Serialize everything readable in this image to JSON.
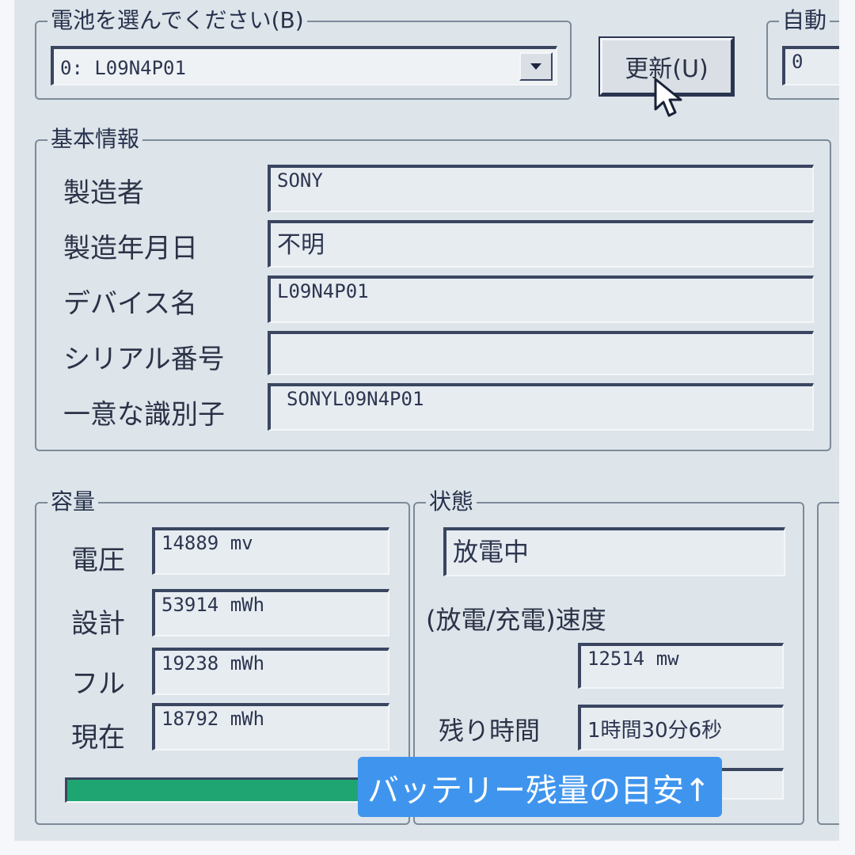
{
  "battery_select": {
    "legend": "電池を選んでください(B)",
    "selected": "0: L09N4P01",
    "refresh_label": "更新(U)"
  },
  "auto_update": {
    "legend": "自動",
    "value": "0"
  },
  "basic_info": {
    "legend": "基本情報",
    "rows": [
      {
        "label": "製造者",
        "value": "SONY"
      },
      {
        "label": "製造年月日",
        "value": "不明"
      },
      {
        "label": "デバイス名",
        "value": "L09N4P01"
      },
      {
        "label": "シリアル番号",
        "value": ""
      },
      {
        "label": "一意な識別子",
        "value": "SONYL09N4P01"
      }
    ]
  },
  "capacity": {
    "legend": "容量",
    "rows": [
      {
        "label": "電圧",
        "value": "14889 mv"
      },
      {
        "label": "設計",
        "value": "53914 mWh"
      },
      {
        "label": "フル",
        "value": "19238 mWh"
      },
      {
        "label": "現在",
        "value": "18792 mWh"
      }
    ],
    "charge_level": 0.98
  },
  "status": {
    "legend": "状態",
    "state": "放電中",
    "rate_label": "(放電/充電)速度",
    "rate_value": "12514 mw",
    "remaining_label": "残り時間",
    "remaining_value": "1時間30分6秒"
  },
  "overlay": {
    "caption": "バッテリー残量の目安↑"
  },
  "colors": {
    "progress_fill": "#1fa572",
    "caption_background": "#3f95ee"
  }
}
